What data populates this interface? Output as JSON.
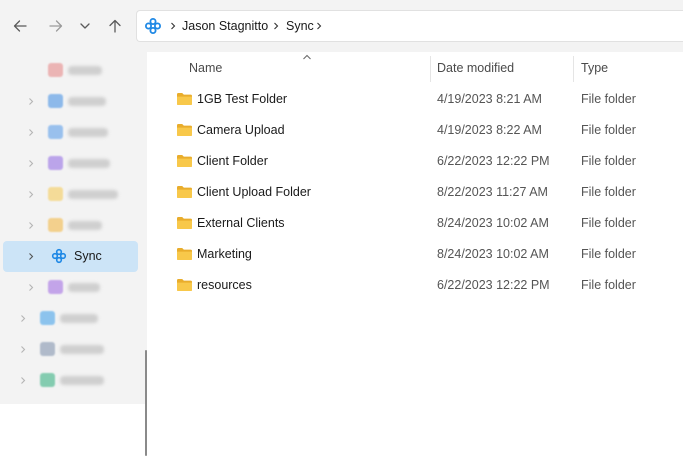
{
  "toolbar": {
    "back_icon": "arrow-left-icon",
    "forward_icon": "arrow-right-icon",
    "recent_icon": "chevron-down-icon",
    "up_icon": "arrow-up-icon"
  },
  "address_bar": {
    "location_icon": "sync-cloud-icon",
    "crumbs": [
      "Jason Stagnitto",
      "Sync"
    ]
  },
  "sidebar": {
    "items": [
      {
        "label": "Music",
        "icon": "music-icon",
        "color": "#e9a0a0",
        "blurred": true
      },
      {
        "label": "OneDrive",
        "icon": "cloud-icon",
        "color": "#6ba6e8",
        "blurred": true
      },
      {
        "label": "Pictures",
        "icon": "pictures-icon",
        "color": "#7cb0ec",
        "blurred": true
      },
      {
        "label": "Proton Drive",
        "icon": "drive-icon",
        "color": "#a98ae8",
        "blurred": true
      },
      {
        "label": "Saved Games",
        "icon": "folder-icon",
        "color": "#f5d47a",
        "blurred": true
      },
      {
        "label": "Searches",
        "icon": "search-folder-icon",
        "color": "#f3c56b",
        "blurred": true
      },
      {
        "label": "Sync",
        "icon": "sync-cloud-icon",
        "color": "#1e88e5",
        "blurred": false
      },
      {
        "label": "Videos",
        "icon": "videos-icon",
        "color": "#b48ae6",
        "blurred": true
      },
      {
        "label": "Desktop",
        "icon": "desktop-icon",
        "color": "#6ab4ec",
        "blurred": true
      },
      {
        "label": "Documents",
        "icon": "documents-icon",
        "color": "#9aa8bd",
        "blurred": true
      },
      {
        "label": "Downloads",
        "icon": "downloads-icon",
        "color": "#5fbf9a",
        "blurred": true
      }
    ]
  },
  "columns": {
    "name": "Name",
    "date_modified": "Date modified",
    "type": "Type"
  },
  "files": [
    {
      "name": "1GB Test Folder",
      "date": "4/19/2023 8:21 AM",
      "type": "File folder"
    },
    {
      "name": "Camera Upload",
      "date": "4/19/2023 8:22 AM",
      "type": "File folder"
    },
    {
      "name": "Client Folder",
      "date": "6/22/2023 12:22 PM",
      "type": "File folder"
    },
    {
      "name": "Client Upload Folder",
      "date": "8/22/2023 11:27 AM",
      "type": "File folder"
    },
    {
      "name": "External Clients",
      "date": "8/24/2023 10:02 AM",
      "type": "File folder"
    },
    {
      "name": "Marketing",
      "date": "8/24/2023 10:02 AM",
      "type": "File folder"
    },
    {
      "name": "resources",
      "date": "6/22/2023 12:22 PM",
      "type": "File folder"
    }
  ],
  "colors": {
    "accent": "#1e88e5",
    "selection": "#cce4f7",
    "folder": "#f8c84a"
  }
}
